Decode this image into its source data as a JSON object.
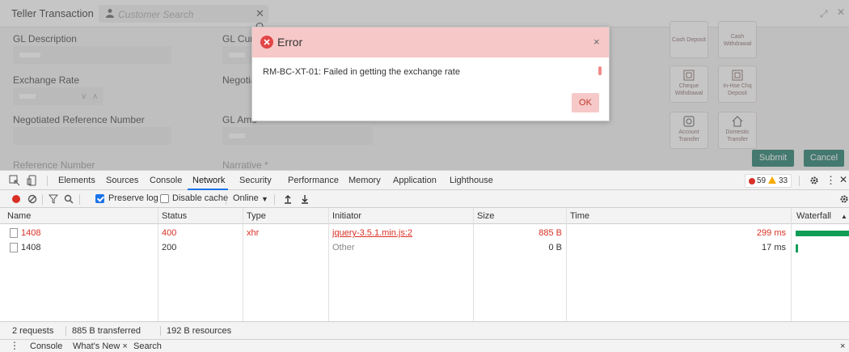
{
  "app": {
    "title": "Teller Transaction",
    "search_placeholder": "Customer Search",
    "search_controls": "✕ Q",
    "form": {
      "gl_description_label": "GL Description",
      "gl_currency_label": "GL Curr",
      "exchange_rate_label": "Exchange Rate",
      "negotiated_label": "Negotia",
      "negotiated_ref_label": "Negotiated Reference Number",
      "gl_amount_label": "GL Amo",
      "reference_number_label": "Reference Number",
      "narrative_label": "Narrative *"
    },
    "tiles": [
      {
        "label": "Cash Deposit"
      },
      {
        "label": "Cash Withdrawal"
      },
      {
        "label": "Cheque Withdrawal"
      },
      {
        "label": "In-Hse Chq Deposit"
      },
      {
        "label": "Account Transfer"
      },
      {
        "label": "Domestic Transfer"
      }
    ],
    "submit_label": "Submit",
    "cancel_label": "Cancel"
  },
  "dialog": {
    "title": "Error",
    "close": "×",
    "message": "RM-BC-XT-01: Failed in getting the exchange rate",
    "ok_label": "OK"
  },
  "devtools": {
    "tabs": [
      "Elements",
      "Sources",
      "Console",
      "Network",
      "Security",
      "Performance",
      "Memory",
      "Application",
      "Lighthouse"
    ],
    "active_tab": "Network",
    "error_count": "59",
    "warning_count": "33",
    "toolbar": {
      "preserve_log": "Preserve log",
      "disable_cache": "Disable cache",
      "throttle": "Online"
    },
    "columns": [
      "Name",
      "Status",
      "Type",
      "Initiator",
      "Size",
      "Time",
      "Waterfall"
    ],
    "rows": [
      {
        "name": "1408",
        "status": "400",
        "type": "xhr",
        "initiator": "jquery-3.5.1.min.js:2",
        "size": "885 B",
        "time": "299 ms"
      },
      {
        "name": "1408",
        "status": "200",
        "type": "",
        "initiator": "Other",
        "size": "0 B",
        "time": "17 ms"
      }
    ],
    "status_bar": {
      "requests": "2 requests",
      "transferred": "885 B transferred",
      "resources": "192 B resources"
    },
    "drawer": {
      "console": "Console",
      "whats_new": "What's New ×",
      "search": "Search",
      "close": "×"
    }
  },
  "colors": {
    "error_red": "#d93025",
    "dialog_header": "#f6c8c8",
    "accent_teal": "#1f7a6a",
    "waterfall_green": "#0f9d58",
    "active_tab_blue": "#1a73e8"
  }
}
